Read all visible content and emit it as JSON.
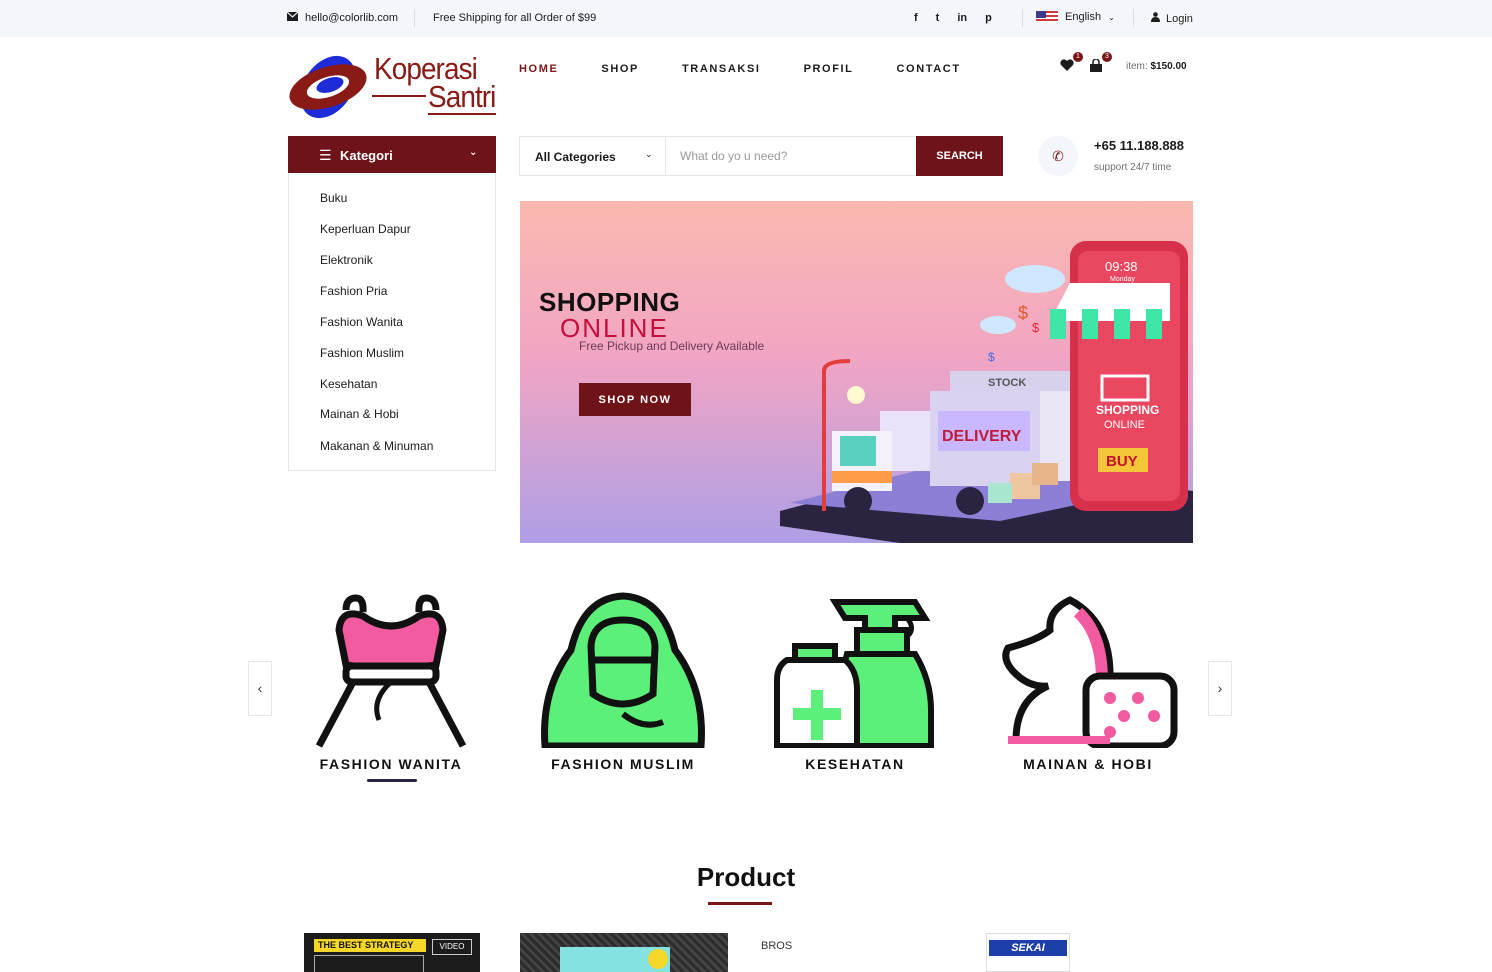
{
  "topbar": {
    "email": "hello@colorlib.com",
    "shipping": "Free Shipping for all Order of $99",
    "social": [
      "f",
      "t",
      "in",
      "p"
    ],
    "language": "English",
    "login": "Login"
  },
  "logo": {
    "line1": "Koperasi",
    "line2": "Santri"
  },
  "nav": {
    "items": [
      "HOME",
      "SHOP",
      "TRANSAKSI",
      "PROFIL",
      "CONTACT"
    ],
    "active": "HOME"
  },
  "header": {
    "wishlist_count": "1",
    "cart_count": "3",
    "item_label": "item:",
    "item_total": "$150.00"
  },
  "category": {
    "title": "Kategori",
    "items": [
      "Buku",
      "Keperluan Dapur",
      "Elektronik",
      "Fashion Pria",
      "Fashion Wanita",
      "Fashion Muslim",
      "Kesehatan",
      "Mainan & Hobi",
      "Makanan & Minuman"
    ]
  },
  "search": {
    "category": "All Categories",
    "placeholder": "What do yo u need?",
    "button": "SEARCH"
  },
  "support": {
    "phone": "+65 11.188.888",
    "text": "support 24/7 time"
  },
  "hero": {
    "title_line1": "SHOPPING",
    "title_line2": "ONLINE",
    "subtitle": "Free Pickup and Delivery Available",
    "button": "SHOP NOW",
    "art_text": {
      "clock": "09:38",
      "day": "Monday",
      "stock": "STOCK",
      "delivery": "DELIVERY",
      "shop1": "SHOPPING",
      "shop2": "ONLINE",
      "buy": "BUY"
    }
  },
  "carousel": {
    "items": [
      "FASHION WANITA",
      "FASHION MUSLIM",
      "KESEHATAN",
      "MAINAN & HOBI"
    ],
    "prev": "‹",
    "next": "›"
  },
  "products": {
    "title": "Product",
    "items": [
      {
        "label": "THE BEST STRATEGY"
      },
      {
        "label": ""
      },
      {
        "label": "BROS"
      },
      {
        "label": "SEKAI"
      }
    ]
  },
  "colors": {
    "accent": "#6e1317",
    "topbar_bg": "#f3f6fa",
    "pink": "#f25ba0",
    "green": "#5cf07a"
  }
}
